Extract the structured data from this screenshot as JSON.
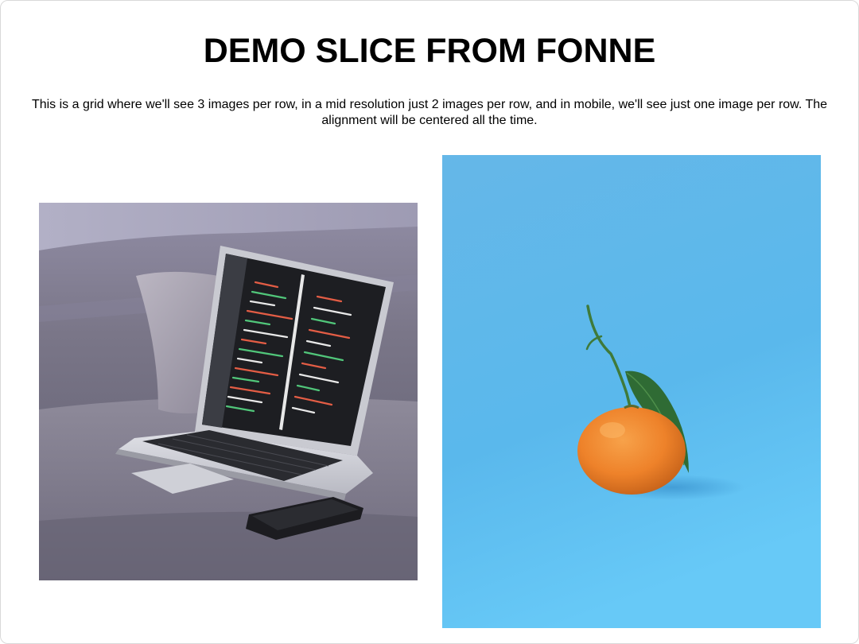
{
  "page": {
    "title": "DEMO SLICE FROM FONNE",
    "description": "This is a grid where we'll see 3 images per row, in a mid resolution just 2 images per row, and in mobile, we'll see just one image per row. The alignment will be centered all the time."
  },
  "grid": {
    "images": [
      {
        "subject": "laptop-on-sofa-with-code-and-phone"
      },
      {
        "subject": "tangerine-with-leaf-on-blue-background"
      }
    ]
  },
  "colors": {
    "background": "#ffffff",
    "text": "#000000",
    "orange_bg": "#5ab8ec",
    "orange_fruit": "#f08a2c"
  }
}
